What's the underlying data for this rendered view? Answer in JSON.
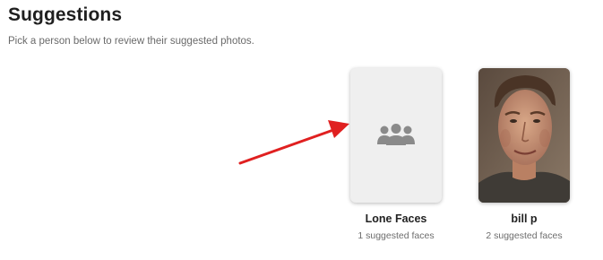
{
  "header": {
    "title": "Suggestions",
    "subtitle": "Pick a person below to review their suggested photos."
  },
  "people": [
    {
      "name": "Lone Faces",
      "suggested": "1 suggested faces",
      "icon": "people-group-icon"
    },
    {
      "name": "bill p",
      "suggested": "2 suggested faces",
      "icon": "face-photo"
    }
  ],
  "colors": {
    "arrow": "#e02020",
    "icon_gray": "#8a8a8a",
    "card_bg": "#efefef"
  }
}
